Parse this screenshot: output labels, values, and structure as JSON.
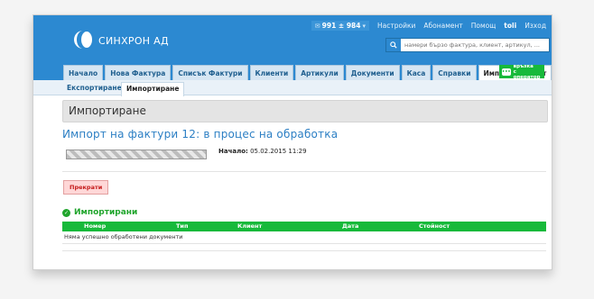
{
  "header": {
    "brand": "СИНХРОН АД",
    "counter": {
      "text": "991 ± 984",
      "icon": "mail-icon",
      "dropdown_icon": "caret-down-icon"
    },
    "links": [
      "Настройки",
      "Абонамент",
      "Помощ"
    ],
    "user": "toli",
    "logout": "Изход",
    "search": {
      "placeholder": "намери бързо фактура, клиент, артикул, ..."
    }
  },
  "nav": {
    "tabs": [
      "Начало",
      "Нова Фактура",
      "Списък Фактури",
      "Клиенти",
      "Артикули",
      "Документи",
      "Каса",
      "Справки",
      "Импорт/експорт"
    ],
    "active": "Импорт/експорт",
    "operator": {
      "line1": "връзка",
      "line2": "с оператор"
    }
  },
  "subnav": {
    "tabs": [
      "Експортиране",
      "Импортиране"
    ],
    "active": "Импортиране"
  },
  "main": {
    "title": "Импортиране",
    "import_heading": "Импорт на фактури 12: в процес на обработка",
    "progress": 0.0,
    "start_label": "Начало:",
    "start_value": "05.02.2015 11:29",
    "stop_button": "Прекрати",
    "imported_title": "Импортирани",
    "table": {
      "columns": [
        "Номер",
        "Тип",
        "Клиент",
        "Дата",
        "Стойност"
      ],
      "empty_message": "Няма успешно обработени документи"
    }
  },
  "colors": {
    "header_blue": "#2c89d1",
    "tab_bg": "#d6e6f3",
    "green": "#17b93a",
    "heading_blue": "#2c7fc4",
    "stop_red": "#c41a1a"
  }
}
